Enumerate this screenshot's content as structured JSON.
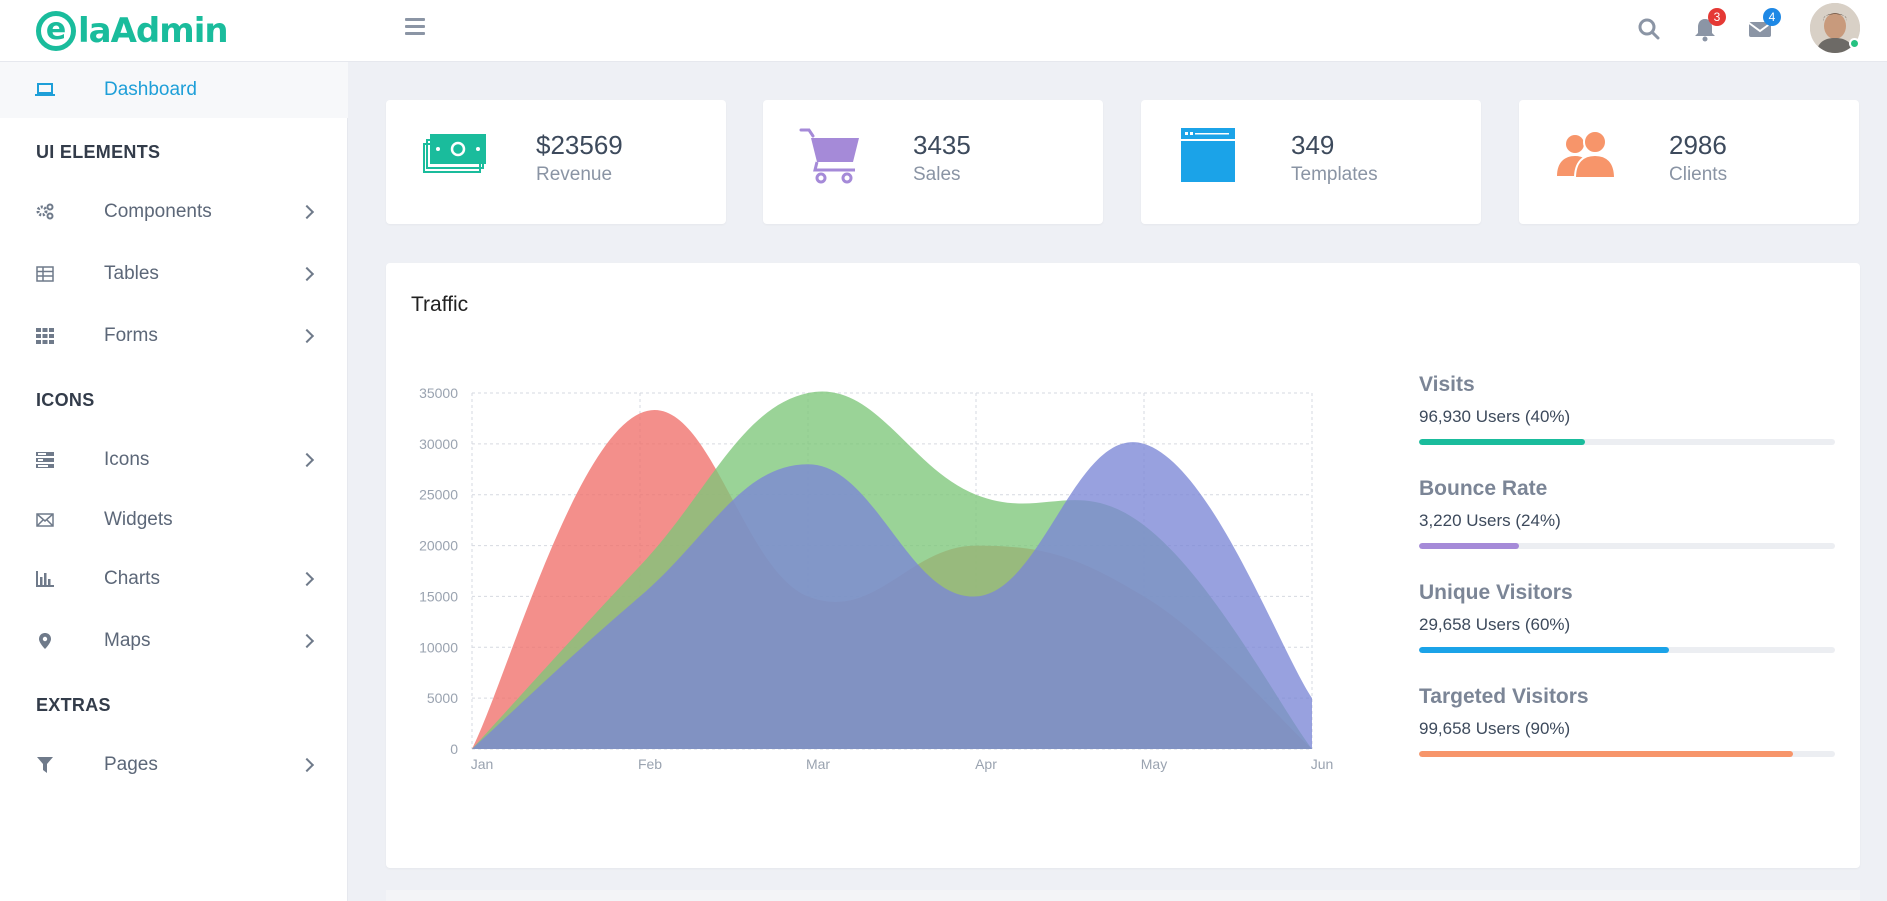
{
  "header": {
    "logo": {
      "e": "e",
      "ela": "la",
      "admin": "Admin"
    },
    "notifications_count": "3",
    "messages_count": "4",
    "icons": {
      "menu": "hamburger-menu-icon",
      "search": "search-icon",
      "bell": "bell-icon",
      "mail": "envelope-icon"
    }
  },
  "sidebar": {
    "dashboard": {
      "label": "Dashboard",
      "icon": "laptop-icon"
    },
    "sections": {
      "ui": "UI ELEMENTS",
      "icons": "ICONS",
      "extras": "EXTRAS"
    },
    "items": [
      {
        "label": "Components",
        "icon": "gears-icon"
      },
      {
        "label": "Tables",
        "icon": "table-icon"
      },
      {
        "label": "Forms",
        "icon": "grid-icon"
      },
      {
        "label": "Icons",
        "icon": "tasks-icon"
      },
      {
        "label": "Widgets",
        "icon": "envelope-icon"
      },
      {
        "label": "Charts",
        "icon": "bar-chart-icon"
      },
      {
        "label": "Maps",
        "icon": "map-marker-icon"
      },
      {
        "label": "Pages",
        "icon": "filter-icon"
      }
    ]
  },
  "stats": [
    {
      "value": "$23569",
      "label": "Revenue",
      "icon": "money-icon",
      "color": "#1abc9c"
    },
    {
      "value": "3435",
      "label": "Sales",
      "icon": "shopping-cart-icon",
      "color": "#a58ad8"
    },
    {
      "value": "349",
      "label": "Templates",
      "icon": "browser-window-icon",
      "color": "#1ba3e8"
    },
    {
      "value": "2986",
      "label": "Clients",
      "icon": "users-icon",
      "color": "#f7956a"
    }
  ],
  "traffic": {
    "title": "Traffic",
    "metrics": [
      {
        "title": "Visits",
        "sub": "96,930 Users (40%)",
        "percent": 40,
        "color": "#1abc9c"
      },
      {
        "title": "Bounce Rate",
        "sub": "3,220 Users (24%)",
        "percent": 24,
        "color": "#a58ad8"
      },
      {
        "title": "Unique Visitors",
        "sub": "29,658 Users (60%)",
        "percent": 60,
        "color": "#1ba3e8"
      },
      {
        "title": "Targeted Visitors",
        "sub": "99,658 Users (90%)",
        "percent": 90,
        "color": "#f7956a"
      }
    ]
  },
  "chart_data": {
    "type": "area",
    "categories": [
      "Jan",
      "Feb",
      "Mar",
      "Apr",
      "May",
      "Jun"
    ],
    "ylim": [
      0,
      35000
    ],
    "yticks": [
      0,
      5000,
      10000,
      15000,
      20000,
      25000,
      30000,
      35000
    ],
    "grid": true,
    "series": [
      {
        "values": [
          0,
          33000,
          15000,
          20000,
          15000,
          0
        ],
        "color": "#f0706a"
      },
      {
        "values": [
          0,
          18000,
          35000,
          25000,
          22000,
          0
        ],
        "color": "#7ec77a"
      },
      {
        "values": [
          0,
          15000,
          28000,
          15000,
          30000,
          5000
        ],
        "color": "#7b86d6"
      }
    ]
  }
}
